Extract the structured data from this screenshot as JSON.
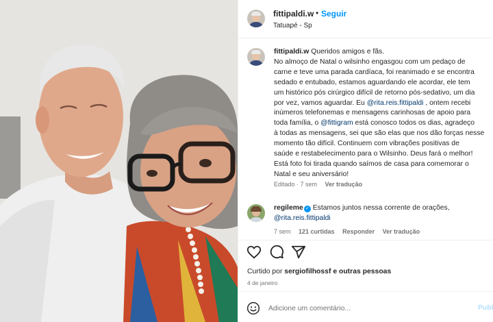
{
  "post": {
    "username": "fittipaldi.w",
    "separator": "•",
    "follow_label": "Seguir",
    "location": "Tatuapé - Sp",
    "avatar_icon": "profile-avatar"
  },
  "caption": {
    "username": "fittipaldi.w",
    "lines": [
      "Queridos amigos e fãs.",
      "No almoço de Natal o wilsinho engasgou com um pedaço de",
      "carne e teve uma parada cardíaca, foi reanimado e se encontra",
      "sedado e entubado, estamos aguardando ele acordar, ele tem",
      "um histórico pós cirúrgico difícil de retorno pós-sedativo, um dia",
      "por vez, vamos aguardar. Eu ",
      ", ontem recebi",
      "inúmeros telefonemas e mensagens carinhosas de apoio para",
      "toda família, o ",
      " está conosco todos os dias, agradeço",
      "à todas as mensagens, sei que são elas que nos dão forças nesse",
      "momento tão difícil. Continuem com vibrações positivas de",
      "saúde e restabelecimento para o Wilsinho. Deus fará o melhor!",
      "Está foto foi tirada quando saímos de casa para comemorar o",
      "Natal e seu aniversário!"
    ],
    "mention_rita": "@rita.reis.fittipaldi",
    "mention_fittigram": "@fittigram",
    "edited": "Editado · 7 sem",
    "translate": "Ver tradução"
  },
  "comment": {
    "username": "regileme",
    "verified_mark": "✓",
    "text_part1": "Estamos juntos nessa corrente de orações,",
    "mention": "@rita.reis.fittipaldi",
    "age": "7 sem",
    "likes": "121 curtidas",
    "reply": "Responder",
    "translate": "Ver tradução"
  },
  "actions": {
    "like_icon": "heart-icon",
    "comment_icon": "comment-icon",
    "share_icon": "share-icon",
    "liked_prefix": "Curtido por ",
    "liked_user": "sergiofilhossf",
    "liked_suffix": " e outras pessoas",
    "date": "4 de janeiro"
  },
  "add_comment": {
    "placeholder": "Adicione um comentário...",
    "publish_label": "Publicar",
    "emoji_icon": "emoji-icon"
  },
  "colors": {
    "link_blue": "#0095f6",
    "mention_blue": "#00376b",
    "muted_text": "#737373"
  }
}
